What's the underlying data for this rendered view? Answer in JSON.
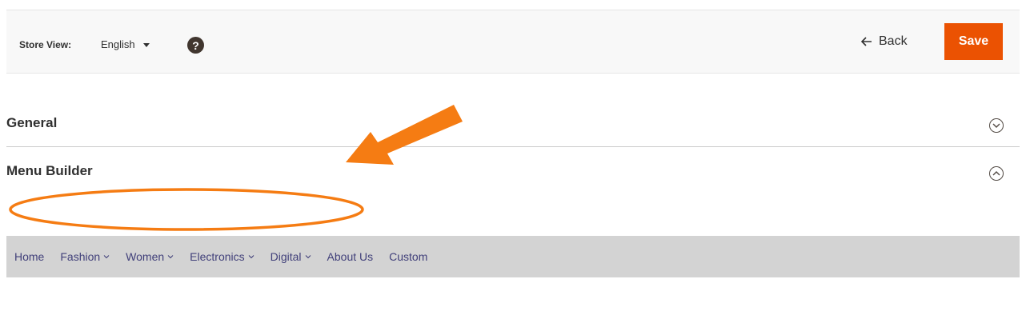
{
  "toolbar": {
    "store_view_label": "Store View:",
    "store_view_value": "English",
    "help_icon": "question-circle-icon",
    "back_label": "Back",
    "save_label": "Save"
  },
  "sections": {
    "general": {
      "title": "General",
      "state": "collapsed"
    },
    "menu_builder": {
      "title": "Menu Builder",
      "state": "expanded"
    }
  },
  "menu": {
    "items": [
      {
        "label": "Home",
        "has_dropdown": false
      },
      {
        "label": "Fashion",
        "has_dropdown": true
      },
      {
        "label": "Women",
        "has_dropdown": true
      },
      {
        "label": "Electronics",
        "has_dropdown": true
      },
      {
        "label": "Digital",
        "has_dropdown": true
      },
      {
        "label": "About Us",
        "has_dropdown": false
      },
      {
        "label": "Custom",
        "has_dropdown": false
      }
    ]
  },
  "colors": {
    "accent": "#eb5202",
    "annotation": "#f57c13",
    "menu_bar": "#d3d3d3",
    "menu_text": "#41407a"
  }
}
